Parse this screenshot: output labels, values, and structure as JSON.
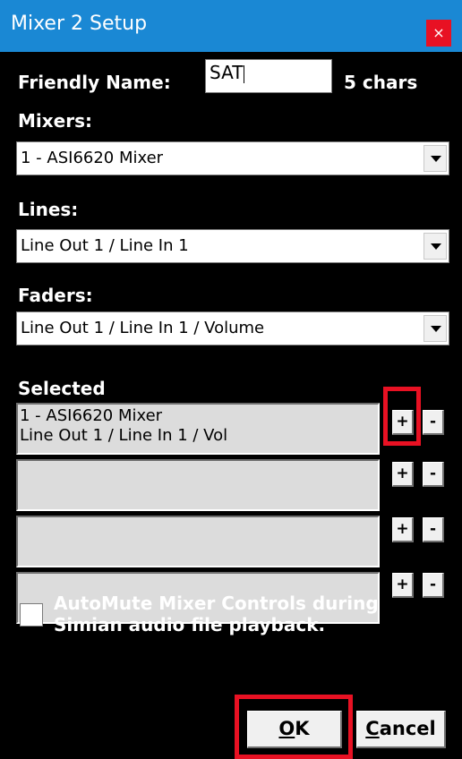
{
  "window": {
    "title": "Mixer 2 Setup",
    "close_glyph": "×"
  },
  "friendly_name": {
    "label": "Friendly Name:",
    "value": "SAT",
    "count_text": "5 chars"
  },
  "mixers": {
    "label": "Mixers:",
    "selected": "1 - ASI6620 Mixer"
  },
  "lines": {
    "label": "Lines:",
    "selected": "Line Out 1 / Line In 1"
  },
  "faders": {
    "label": "Faders:",
    "selected": "Line Out 1 / Line In 1 / Volume"
  },
  "selected_section": {
    "label": "Selected",
    "slots": [
      {
        "line1": "1 - ASI6620 Mixer",
        "line2": "Line Out 1 / Line In 1 / Vol"
      },
      {
        "line1": "",
        "line2": ""
      },
      {
        "line1": "",
        "line2": ""
      },
      {
        "line1": "",
        "line2": ""
      }
    ],
    "add_label": "+",
    "remove_label": "-"
  },
  "automute": {
    "label_line1": "AutoMute Mixer Controls during",
    "label_line2": "Simian audio file playback.",
    "checked": false
  },
  "buttons": {
    "ok_mnemonic": "O",
    "ok_rest": "K",
    "cancel_mnemonic": "C",
    "cancel_rest": "ancel"
  },
  "colors": {
    "titlebar": "#1a88d4",
    "close": "#e81123",
    "highlight": "#e81123",
    "background": "#000000"
  },
  "icons": {
    "combo_arrow": "chevron-down-icon",
    "close": "close-icon"
  }
}
